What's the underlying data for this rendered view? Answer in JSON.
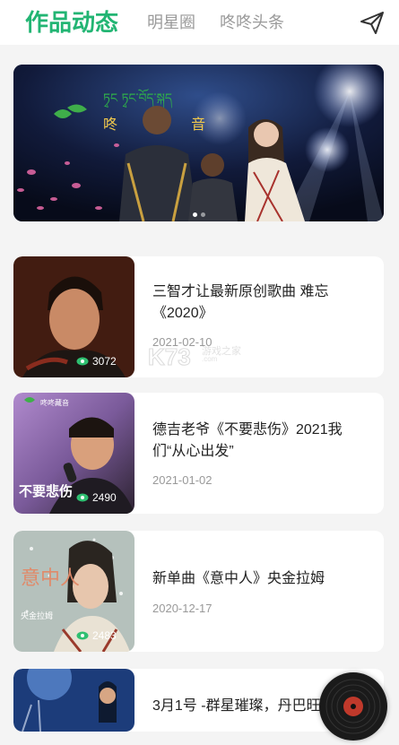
{
  "header": {
    "tabs": [
      {
        "label": "作品动态",
        "active": true
      },
      {
        "label": "明星圈",
        "active": false
      },
      {
        "label": "咚咚头条",
        "active": false
      }
    ],
    "send_icon": "paper-plane-icon",
    "accent_color": "#22b573"
  },
  "banner": {
    "logo_text": "咚 藏 音",
    "tibetan_text": "ཏྭང ཏྭང་བོད་སྐད",
    "slides_total": 2,
    "slide_active": 1
  },
  "posts": [
    {
      "title": "三智才让最新原创歌曲 难忘《2020》",
      "date": "2021-02-10",
      "views": "3072"
    },
    {
      "title": "德吉老爷《不要悲伤》2021我们“从心出发”",
      "date": "2021-01-02",
      "views": "2490",
      "thumb_caption": "不要悲伤",
      "thumb_brand": "咚咚藏音"
    },
    {
      "title": "新单曲《意中人》央金拉姆",
      "date": "2020-12-17",
      "views": "2483",
      "thumb_caption": "意中人",
      "thumb_name": "央金拉姆"
    },
    {
      "title": "3月1号 -群星璀璨，丹巴旺",
      "date": "",
      "views": ""
    }
  ],
  "watermark": {
    "main": "K73",
    "sub": "游戏之家",
    "url": ".com"
  },
  "player": {
    "icon": "vinyl-record-icon"
  }
}
